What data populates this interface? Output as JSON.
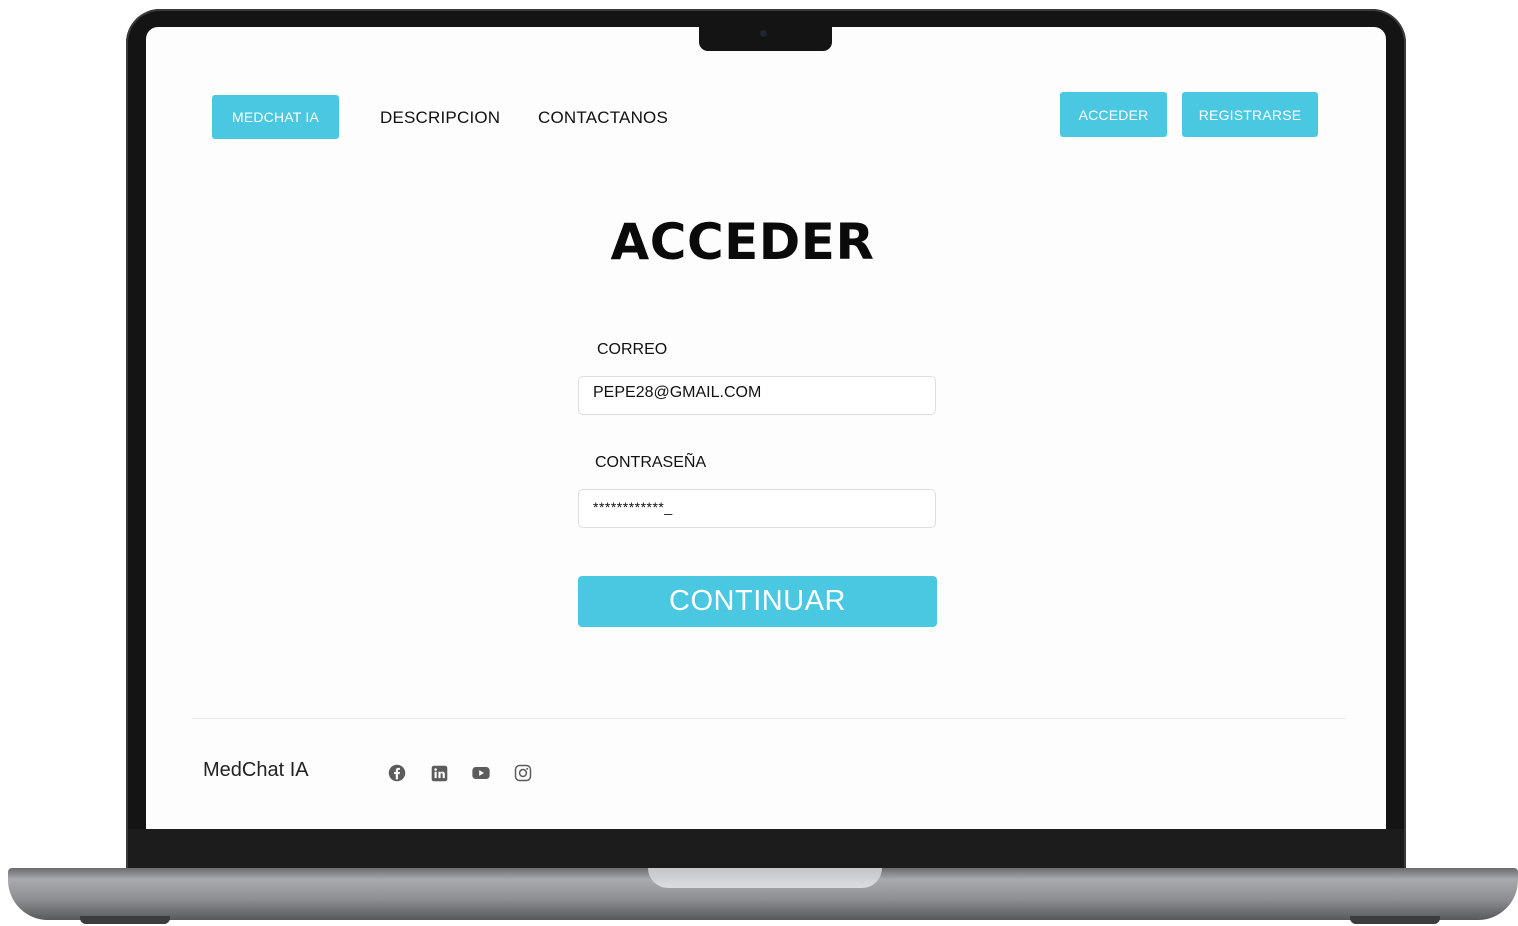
{
  "nav": {
    "brand_button": "MEDCHAT IA",
    "links": [
      "DESCRIPCION",
      "CONTACTANOS"
    ],
    "login_button": "ACCEDER",
    "register_button": "REGISTRARSE"
  },
  "page": {
    "title": "ACCEDER"
  },
  "form": {
    "email_label": "CORREO",
    "email_value": "PEPE28@GMAIL.COM",
    "password_label": "CONTRASEÑA",
    "password_value": "************_",
    "submit_label": "CONTINUAR"
  },
  "footer": {
    "brand": "MedChat IA",
    "social_icons": [
      "facebook-icon",
      "linkedin-icon",
      "youtube-icon",
      "instagram-icon"
    ]
  },
  "colors": {
    "accent": "#4ac8e2",
    "text": "#111111",
    "icon": "#5c5c5c",
    "screen_background": "#fdfdfd"
  }
}
